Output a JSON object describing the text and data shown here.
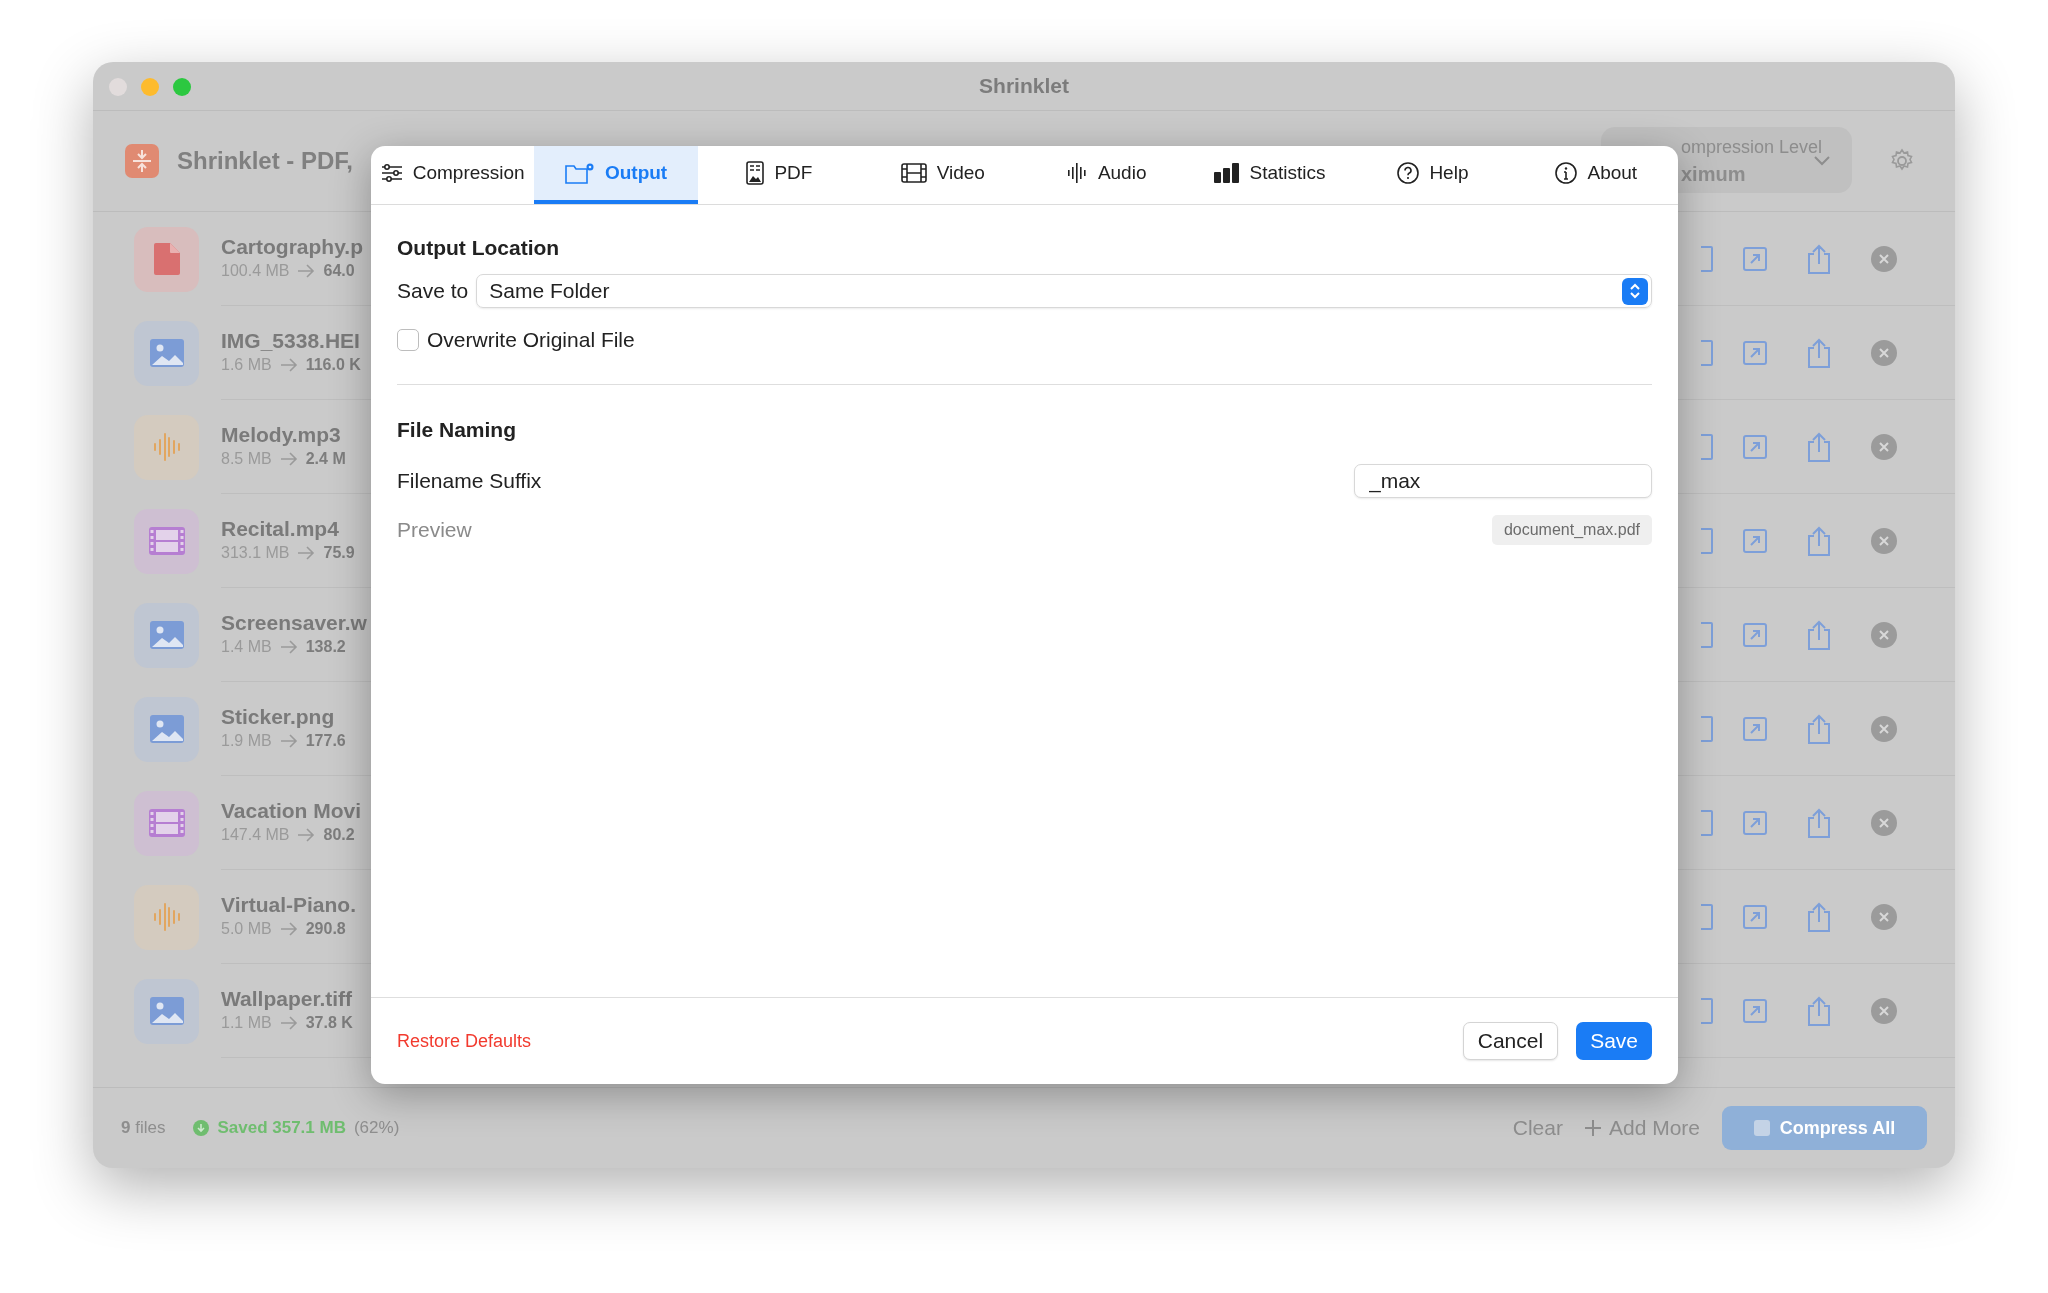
{
  "window": {
    "title": "Shrinklet"
  },
  "header": {
    "title": "Shrinklet - PDF,",
    "compression_level": {
      "label": "ompression Level",
      "value": "ximum"
    }
  },
  "files": [
    {
      "kind": "pdf",
      "name": "Cartography.p",
      "original_size": "100.4 MB",
      "compressed_size": "64.0"
    },
    {
      "kind": "image",
      "name": "IMG_5338.HEI",
      "original_size": "1.6 MB",
      "compressed_size": "116.0 K"
    },
    {
      "kind": "audio",
      "name": "Melody.mp3",
      "original_size": "8.5 MB",
      "compressed_size": "2.4 M"
    },
    {
      "kind": "video",
      "name": "Recital.mp4",
      "original_size": "313.1 MB",
      "compressed_size": "75.9"
    },
    {
      "kind": "image",
      "name": "Screensaver.w",
      "original_size": "1.4 MB",
      "compressed_size": "138.2"
    },
    {
      "kind": "image",
      "name": "Sticker.png",
      "original_size": "1.9 MB",
      "compressed_size": "177.6"
    },
    {
      "kind": "video",
      "name": "Vacation Movi",
      "original_size": "147.4 MB",
      "compressed_size": "80.2"
    },
    {
      "kind": "audio",
      "name": "Virtual-Piano.",
      "original_size": "5.0 MB",
      "compressed_size": "290.8"
    },
    {
      "kind": "image",
      "name": "Wallpaper.tiff",
      "original_size": "1.1 MB",
      "compressed_size": "37.8 K"
    }
  ],
  "status_bar": {
    "count": "9",
    "count_label": "files",
    "saved": "Saved 357.1 MB",
    "percent": "(62%)",
    "clear": "Clear",
    "add_more": "Add More",
    "compress_all": "Compress All"
  },
  "dialog": {
    "tabs": [
      {
        "kind": "sliders",
        "label": "Compression",
        "selected": false
      },
      {
        "kind": "folder",
        "label": "Output",
        "selected": true
      },
      {
        "kind": "document",
        "label": "PDF",
        "selected": false
      },
      {
        "kind": "film",
        "label": "Video",
        "selected": false
      },
      {
        "kind": "waveform",
        "label": "Audio",
        "selected": false
      },
      {
        "kind": "bars",
        "label": "Statistics",
        "selected": false
      },
      {
        "kind": "question",
        "label": "Help",
        "selected": false
      },
      {
        "kind": "info",
        "label": "About",
        "selected": false
      }
    ],
    "output_location": {
      "heading": "Output Location",
      "save_to_label": "Save to",
      "save_to_value": "Same Folder",
      "overwrite": {
        "label": "Overwrite Original File",
        "checked": false
      }
    },
    "file_naming": {
      "heading": "File Naming",
      "suffix_label": "Filename Suffix",
      "suffix_value": "_max",
      "preview_label": "Preview",
      "preview_value": "document_max.pdf"
    },
    "footer": {
      "restore": "Restore Defaults",
      "cancel": "Cancel",
      "save": "Save"
    }
  }
}
